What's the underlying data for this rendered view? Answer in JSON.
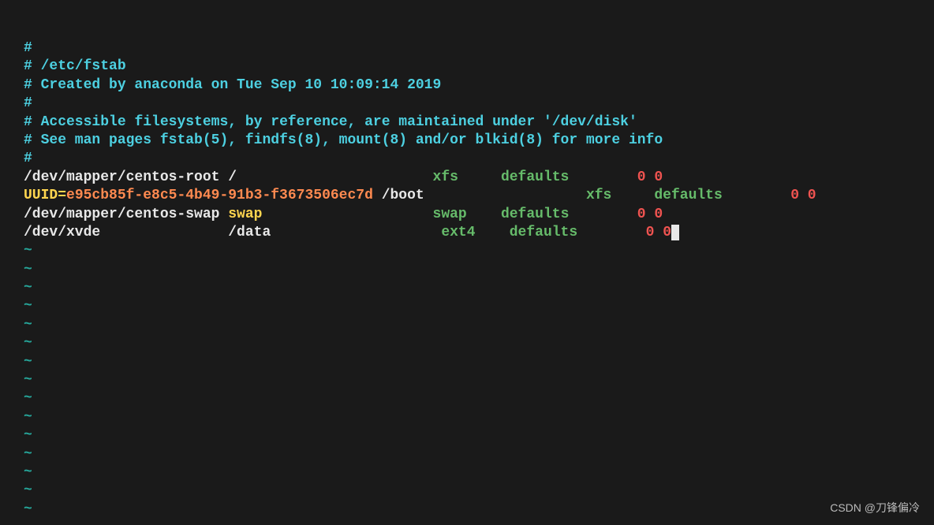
{
  "comments": {
    "l1": "#",
    "l2": "# /etc/fstab",
    "l3": "# Created by anaconda on Tue Sep 10 10:09:14 2019",
    "l4": "#",
    "l5a": "# Accessible ",
    "l5b": "filesystems, by reference, are maintained under '/dev/disk'",
    "l6a": "# See man ",
    "l6b": "pages fstab(5), findfs(8), mount(8) and/or blkid(8) for more info",
    "l7": "#"
  },
  "entries": {
    "root": {
      "device": "/dev/mapper/centos-root",
      "mount": " /",
      "pad1": "                       ",
      "fstype": "xfs",
      "pad2": "     ",
      "options": "defaults",
      "pad3": "        ",
      "dump": "0 0"
    },
    "boot": {
      "uuid_label": "UUID=",
      "uuid": "e95cb85f-e8c5-4b49-91b3-f3673506ec7d",
      "mount": " /boot",
      "pad1": "                   ",
      "fstype": "xfs",
      "pad2": "     ",
      "options": "defaults",
      "pad3": "        ",
      "dump": "0 0"
    },
    "swap": {
      "device": "/dev/mapper/centos-swap",
      "mount": " swap",
      "pad1": "                    ",
      "fstype": "swap",
      "pad2": "    ",
      "options": "defaults",
      "pad3": "        ",
      "dump": "0 0"
    },
    "data": {
      "device": "/dev/xvde",
      "pad0": "               ",
      "mount": "/data",
      "pad1": "                    ",
      "fstype": "ext4",
      "pad2": "    ",
      "options": "defaults",
      "pad3": "        ",
      "dump": "0 0"
    }
  },
  "tilde": "~",
  "watermark": "CSDN @刀锋偏冷"
}
